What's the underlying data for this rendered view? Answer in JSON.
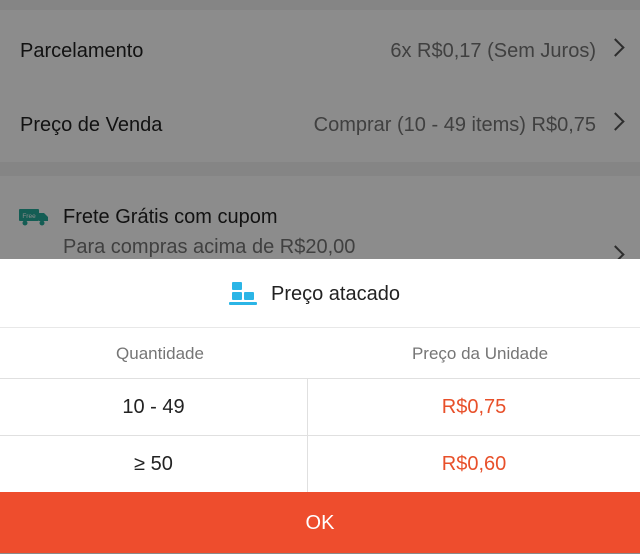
{
  "background": {
    "installments": {
      "label": "Parcelamento",
      "value": "6x R$0,17 (Sem Juros)"
    },
    "sale_price": {
      "label": "Preço de Venda",
      "value": "Comprar (10 - 49 items) R$0,75"
    },
    "shipping": {
      "badge": "Free",
      "title": "Frete Grátis com cupom",
      "subtitle": "Para compras acima de R$20,00"
    }
  },
  "sheet": {
    "title": "Preço atacado",
    "columns": {
      "quantity": "Quantidade",
      "unit_price": "Preço da Unidade"
    },
    "rows": [
      {
        "quantity": "10 - 49",
        "price": "R$0,75"
      },
      {
        "quantity": "≥ 50",
        "price": "R$0,60"
      }
    ],
    "ok_label": "OK"
  },
  "colors": {
    "accent": "#ee4d2d",
    "price": "#e8502a",
    "ship_green": "#26aa99",
    "icon_blue": "#2bb5e6"
  }
}
